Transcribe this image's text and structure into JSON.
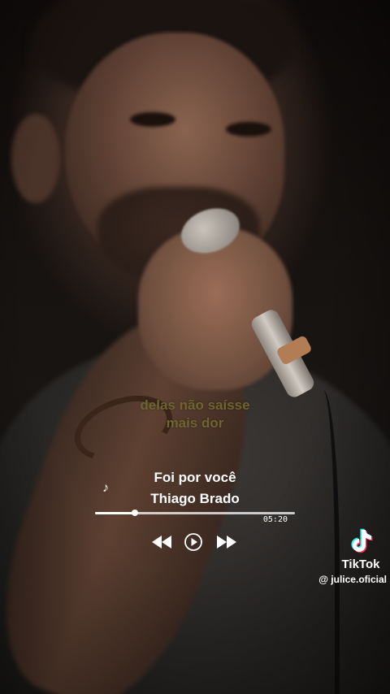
{
  "video": {
    "lyrics_line1": "delas não saísse",
    "lyrics_line2": "mais dor"
  },
  "player": {
    "icon": "music-note-icon",
    "song_title": "Foi por você",
    "artist": "Thiago Brado",
    "progress": 0.2,
    "duration": "05:20",
    "controls": {
      "prev_icon": "previous-icon",
      "play_icon": "play-icon",
      "next_icon": "next-icon"
    }
  },
  "watermark": {
    "brand": "TikTok",
    "handle": "@ julice.oficial"
  },
  "colors": {
    "lyrics": "#6e6530",
    "text": "#ffffff",
    "tiktok_cyan": "#25f4ee",
    "tiktok_red": "#fe2c55"
  }
}
